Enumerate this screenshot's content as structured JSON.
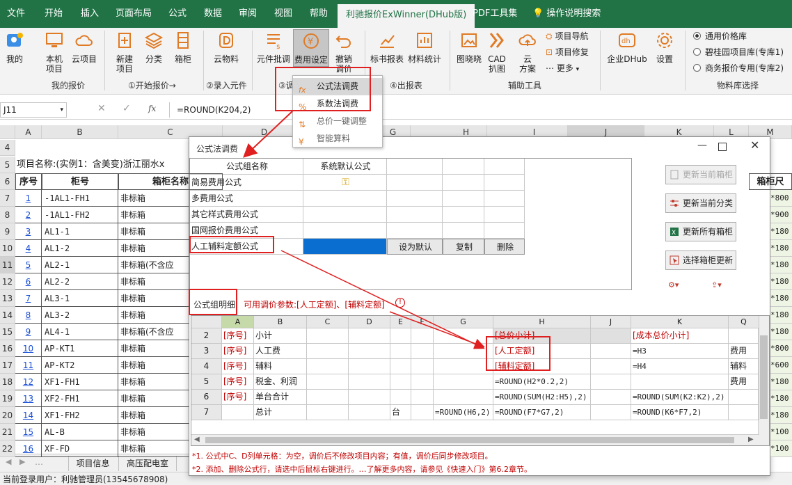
{
  "ribbon_tabs": [
    "文件",
    "开始",
    "插入",
    "页面布局",
    "公式",
    "数据",
    "审阅",
    "视图",
    "帮助",
    "利驰报价ExWinner(DHub版)",
    "PDF工具集",
    "操作说明搜索"
  ],
  "ribbon": {
    "wode": "我的",
    "local": "本机\n项目",
    "cloud": "云项目",
    "new_proj": "新建\n项目",
    "classify": "分类",
    "box": "箱柜",
    "cloud_mat": "云物料",
    "elem_price": "元件批调",
    "fee_set": "费用设定",
    "undo": "撤销\n调价",
    "bid_report": "标书报表",
    "mat_stat": "材料统计",
    "tuxiaoxiao": "图晓晓",
    "cad": "CAD\n扒图",
    "cloud_scheme": "云\n方案",
    "proj_nav": "项目导航",
    "proj_fix": "项目修复",
    "more": "更多",
    "dhub": "企业DHub",
    "settings": "设置",
    "price_lib_1": "通用价格库",
    "price_lib_2": "碧桂园项目库(专库1)",
    "price_lib_3": "商务报价专用(专库2)",
    "group_my": "我的报价",
    "group_start": "①开始报价→",
    "group_input": "②录入元件",
    "group_3": "③调",
    "group_report": "④出报表",
    "group_aux": "辅助工具",
    "group_lib": "物料库选择"
  },
  "dropdown": [
    "公式法调费",
    "系数法调费",
    "总价一键调整",
    "智能算料"
  ],
  "formula_bar": {
    "cell": "J11",
    "formula": "=ROUND(K204,2)"
  },
  "sheet": {
    "col_headers": [
      "A",
      "B",
      "C",
      "D",
      "G",
      "H",
      "I",
      "J",
      "K",
      "L",
      "M"
    ],
    "project_title": "项目名称:(实例1：含美变)浙江丽水x",
    "header_row": [
      "序号",
      "柜号",
      "箱柜名称",
      "箱柜尺"
    ],
    "row_numbers": [
      "4",
      "5",
      "6",
      "7",
      "8",
      "9",
      "10",
      "11",
      "12",
      "13",
      "14",
      "15",
      "16",
      "17",
      "18",
      "19",
      "20",
      "21",
      "22"
    ],
    "rows": [
      {
        "no": "1",
        "code": "-1AL1-FH1",
        "name": "非标箱",
        "size": "*800"
      },
      {
        "no": "2",
        "code": "-1AL1-FH2",
        "name": "非标箱",
        "size": "*900"
      },
      {
        "no": "3",
        "code": "AL1-1",
        "name": "非标箱",
        "size": "*180"
      },
      {
        "no": "4",
        "code": "AL1-2",
        "name": "非标箱",
        "size": "*180"
      },
      {
        "no": "5",
        "code": "AL2-1",
        "name": "非标箱(不含应",
        "size": "*180"
      },
      {
        "no": "6",
        "code": "AL2-2",
        "name": "非标箱",
        "size": "*180"
      },
      {
        "no": "7",
        "code": "AL3-1",
        "name": "非标箱",
        "size": "*180"
      },
      {
        "no": "8",
        "code": "AL3-2",
        "name": "非标箱",
        "size": "*180"
      },
      {
        "no": "9",
        "code": "AL4-1",
        "name": "非标箱(不含应",
        "size": "*180"
      },
      {
        "no": "10",
        "code": "AP-KT1",
        "name": "非标箱",
        "size": "*800"
      },
      {
        "no": "11",
        "code": "AP-KT2",
        "name": "非标箱",
        "size": "*600"
      },
      {
        "no": "12",
        "code": "XF1-FH1",
        "name": "非标箱",
        "size": "*180"
      },
      {
        "no": "13",
        "code": "XF2-FH1",
        "name": "非标箱",
        "size": "*180"
      },
      {
        "no": "14",
        "code": "XF1-FH2",
        "name": "非标箱",
        "size": "*180"
      },
      {
        "no": "15",
        "code": "AL-B",
        "name": "非标箱",
        "size": "*100"
      },
      {
        "no": "16",
        "code": "XF-FD",
        "name": "非标箱",
        "size": "*100"
      }
    ]
  },
  "dialog": {
    "title": "公式法调费",
    "table_header": [
      "公式组名称",
      "系统默认公式"
    ],
    "groups": [
      "简易费用公式",
      "多费用公式",
      "其它样式费用公式",
      "国网报价费用公式",
      "人工辅料定额公式"
    ],
    "row_buttons": [
      "设为默认",
      "复制",
      "删除"
    ],
    "side_buttons": [
      "更新当前箱柜",
      "更新当前分类",
      "更新所有箱柜",
      "选择箱柜更新"
    ],
    "detail_label": "公式组明细",
    "hint": "可用调价参数:[人工定额]、[辅料定额]",
    "detail_cols": [
      "A",
      "B",
      "C",
      "D",
      "E",
      "F",
      "G",
      "H",
      "J",
      "K",
      "Q"
    ],
    "detail_rows": [
      {
        "rn": "2",
        "a": "[序号]",
        "b": "小计",
        "e": "",
        "g": "",
        "h": "[总价小计]",
        "k": "[成本总价小计]",
        "q": ""
      },
      {
        "rn": "3",
        "a": "[序号]",
        "b": "人工费",
        "e": "",
        "g": "",
        "h": "[人工定额]",
        "k": "=H3",
        "q": "费用"
      },
      {
        "rn": "4",
        "a": "[序号]",
        "b": "辅料",
        "e": "",
        "g": "",
        "h": "[辅料定额]",
        "k": "=H4",
        "q": "辅料"
      },
      {
        "rn": "5",
        "a": "[序号]",
        "b": "税金、利润",
        "e": "",
        "g": "",
        "h": "=ROUND(H2*0.2,2)",
        "k": "",
        "q": "费用"
      },
      {
        "rn": "6",
        "a": "[序号]",
        "b": "单台合计",
        "e": "",
        "g": "",
        "h": "=ROUND(SUM(H2:H5),2)",
        "k": "=ROUND(SUM(K2:K2),2)",
        "q": ""
      },
      {
        "rn": "7",
        "a": "",
        "b": "总计",
        "e": "台",
        "g": "=ROUND(H6,2)",
        "h": "=ROUND(F7*G7,2)",
        "k": "=ROUND(K6*F7,2)",
        "q": ""
      }
    ],
    "notes": [
      "*1. 公式中C、D列单元格：为空，调价后不修改项目内容；有值，调价后同步修改项目。",
      "*2. 添加、删除公式行，请选中后鼠标右键进行。…了解更多内容，请参见《快速入门》第6.2章节。"
    ]
  },
  "sheet_tabs": [
    "项目信息",
    "高压配电室"
  ],
  "status": "当前登录用户：利驰管理员(13545678908)",
  "colors": {
    "excel_green": "#217346",
    "highlight_blue": "#0a6ed1",
    "annotation_red": "#e02020"
  }
}
